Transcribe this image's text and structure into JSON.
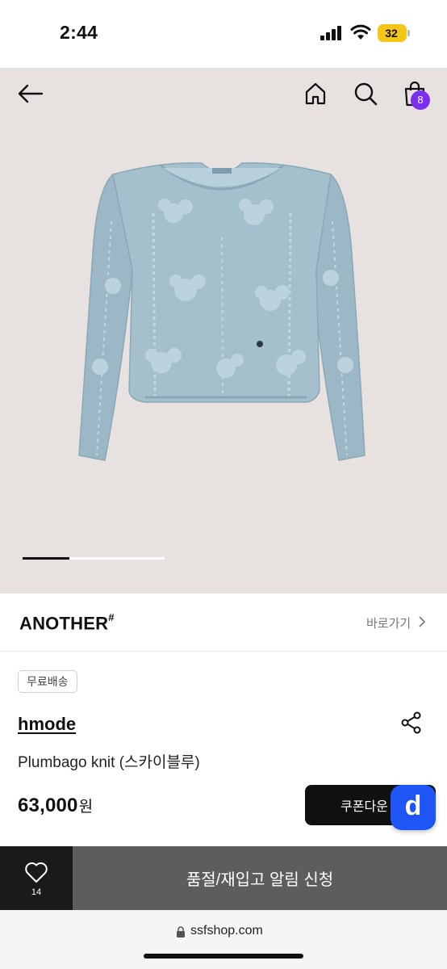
{
  "status_bar": {
    "time": "2:44",
    "battery": "32",
    "battery_color": "#f5c518"
  },
  "header": {
    "back_icon": "arrow-left-icon",
    "home_icon": "home-icon",
    "search_icon": "search-icon",
    "bag_icon": "shopping-bag-icon",
    "bag_count": "8",
    "badge_color": "#7a2ff0"
  },
  "carousel": {
    "image": "light blue floral pointelle knit sweater",
    "active_index": 1
  },
  "brand": {
    "name": "ANOTHER",
    "mark": "#",
    "link_label": "바로가기"
  },
  "product": {
    "shipping_tag": "무료배송",
    "maker": "hmode",
    "name": "Plumbago knit (스카이블루)",
    "price": "63,000",
    "currency": "원",
    "coupon_label": "쿠폰다운",
    "floating_button_label": "d",
    "floating_button_color": "#1f55f5"
  },
  "action_bar": {
    "like_count": "14",
    "restock_label": "품절/재입고 알림 신청"
  },
  "browser": {
    "url": "ssfshop.com"
  }
}
